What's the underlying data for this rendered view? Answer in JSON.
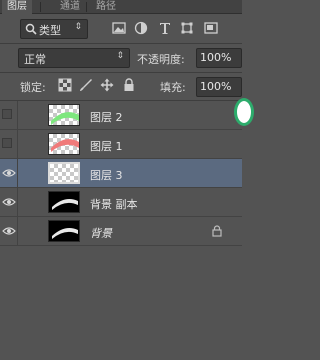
{
  "tabs": [
    {
      "label": "图层",
      "active": true
    },
    {
      "label": "通道",
      "active": false
    },
    {
      "label": "路径",
      "active": false
    }
  ],
  "filter": {
    "kind_label": "类型",
    "icons": [
      "image-filter-icon",
      "adjustment-filter-icon",
      "type-filter-icon",
      "shape-filter-icon",
      "smart-object-filter-icon"
    ]
  },
  "blend": {
    "mode": "正常",
    "opacity_label": "不透明度:",
    "opacity_value": "100%"
  },
  "lock": {
    "label": "锁定:",
    "icons": [
      "lock-transparent-pixels-icon",
      "lock-image-pixels-icon",
      "lock-position-icon",
      "lock-all-icon"
    ],
    "fill_label": "填充:",
    "fill_value": "100%"
  },
  "layers": [
    {
      "name": "图层 2",
      "visible": false,
      "selected": false,
      "thumb": "checker-green",
      "italic": false,
      "locked": false
    },
    {
      "name": "图层 1",
      "visible": false,
      "selected": false,
      "thumb": "checker-red",
      "italic": false,
      "locked": false
    },
    {
      "name": "图层 3",
      "visible": true,
      "selected": true,
      "thumb": "checker",
      "italic": false,
      "locked": false
    },
    {
      "name": "背景 副本",
      "visible": true,
      "selected": false,
      "thumb": "black-white",
      "italic": false,
      "locked": false
    },
    {
      "name": "背景",
      "visible": true,
      "selected": false,
      "thumb": "black-white",
      "italic": true,
      "locked": true
    }
  ],
  "colors": {
    "panel_bg": "#535353",
    "selection": "#5b6a80",
    "accent_green": "#2dac6c"
  }
}
